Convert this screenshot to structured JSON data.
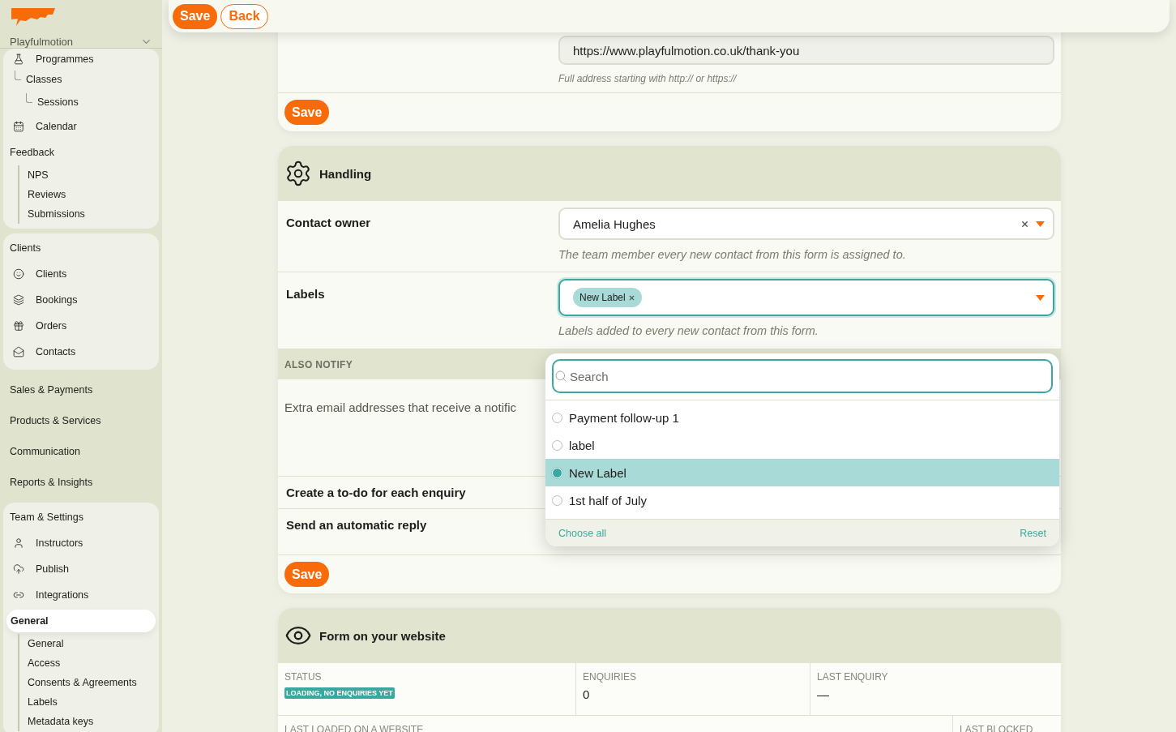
{
  "topbar": {
    "buttons": [
      {
        "label": "Save",
        "kind": "primary"
      },
      {
        "label": "Back",
        "kind": "outline"
      }
    ]
  },
  "sidebar": {
    "account": "Playfulmotion",
    "groups": [
      {
        "kind": "card",
        "items": [
          {
            "label": "Programmes",
            "kind": "icon",
            "selected": false
          },
          {
            "label": "Classes",
            "kind": "tree",
            "selected": false
          },
          {
            "label": "Sessions",
            "kind": "tree2",
            "selected": false
          },
          {
            "label": "Calendar",
            "kind": "icon",
            "selected": false
          },
          {
            "label": "Feedback",
            "kind": "heading",
            "selected": false
          },
          {
            "label": "NPS",
            "kind": "sub",
            "selected": false
          },
          {
            "label": "Reviews",
            "kind": "sub",
            "selected": false
          },
          {
            "label": "Submissions",
            "kind": "sub",
            "selected": false
          }
        ]
      },
      {
        "kind": "card",
        "items": [
          {
            "label": "Clients",
            "kind": "heading",
            "selected": false
          },
          {
            "label": "Clients",
            "kind": "icon",
            "selected": false
          },
          {
            "label": "Bookings",
            "kind": "icon",
            "selected": false
          },
          {
            "label": "Orders",
            "kind": "icon",
            "selected": false
          },
          {
            "label": "Contacts",
            "kind": "icon",
            "selected": false
          }
        ]
      },
      {
        "kind": "plain",
        "items": [
          {
            "label": "Sales & Payments",
            "kind": "heading",
            "selected": false
          },
          {
            "label": "Products & Services",
            "kind": "heading",
            "selected": false
          },
          {
            "label": "Communication",
            "kind": "heading",
            "selected": false
          },
          {
            "label": "Reports & Insights",
            "kind": "heading",
            "selected": false
          }
        ]
      },
      {
        "kind": "card",
        "items": [
          {
            "label": "Team & Settings",
            "kind": "heading",
            "selected": false
          },
          {
            "label": "Instructors",
            "kind": "icon",
            "selected": false
          },
          {
            "label": "Publish",
            "kind": "icon",
            "selected": false
          },
          {
            "label": "Integrations",
            "kind": "icon",
            "selected": false
          },
          {
            "label": "General",
            "kind": "heading",
            "selected": true
          },
          {
            "label": "General",
            "kind": "sub",
            "selected": false
          },
          {
            "label": "Access",
            "kind": "sub",
            "selected": false
          },
          {
            "label": "Consents & Agreements",
            "kind": "sub",
            "selected": false
          },
          {
            "label": "Labels",
            "kind": "sub",
            "selected": false
          },
          {
            "label": "Metadata keys",
            "kind": "sub",
            "selected": false
          }
        ]
      }
    ]
  },
  "url_card": {
    "value": "https://www.playfulmotion.co.uk/thank-you",
    "hint": "Full address starting with http:// or https://",
    "save": "Save"
  },
  "handling": {
    "title": "Handling",
    "rows": [
      {
        "kind": "select",
        "label": "Contact owner",
        "value": "Amelia Hughes",
        "hint": "The team member every new contact from this form is assigned to."
      },
      {
        "kind": "multiselect",
        "label": "Labels",
        "chips": [
          "New Label"
        ],
        "hint": "Labels added to every new contact from this form.",
        "expanded": true
      }
    ],
    "section": "ALSO NOTIFY",
    "notify_text": "Extra email addresses that receive a notific",
    "toggles": [
      "Create a to-do for each enquiry",
      "Send an automatic reply"
    ],
    "save": "Save"
  },
  "dropdown": {
    "placeholder": "Search",
    "options": [
      {
        "label": "Payment follow-up 1",
        "selected": false
      },
      {
        "label": "label",
        "selected": false
      },
      {
        "label": "New Label",
        "selected": true
      },
      {
        "label": "1st half of July",
        "selected": false
      }
    ],
    "choose_all": "Choose all",
    "reset": "Reset"
  },
  "website": {
    "title": "Form on your website",
    "stats": [
      {
        "label": "STATUS",
        "kind": "badge",
        "value": "LOADING, NO ENQUIRIES YET"
      },
      {
        "label": "ENQUIRIES",
        "kind": "text",
        "value": "0"
      },
      {
        "label": "LAST ENQUIRY",
        "kind": "text",
        "value": "—"
      }
    ],
    "stats2": [
      "LAST LOADED ON A WEBSITE",
      "LAST BLOCKED"
    ]
  }
}
